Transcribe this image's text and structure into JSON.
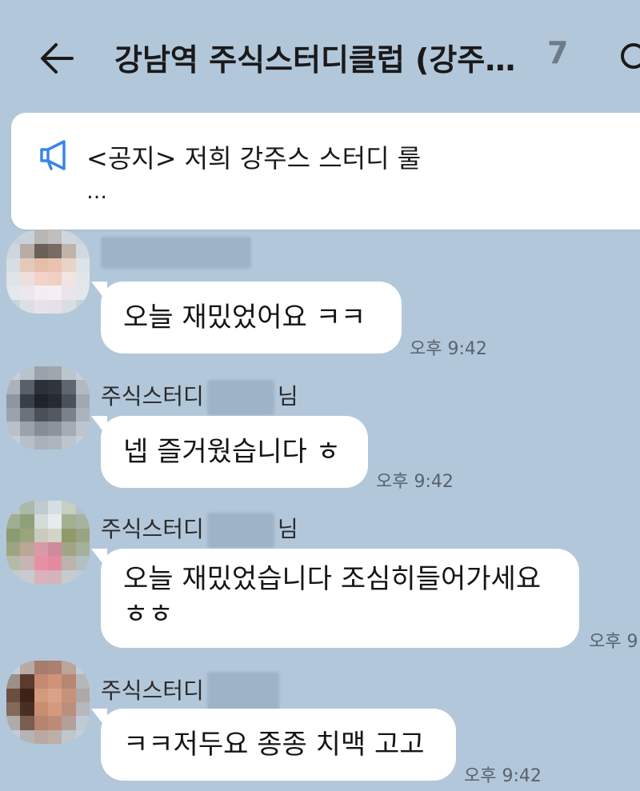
{
  "header": {
    "title": "강남역 주식스터디클럽 (강주…",
    "member_count": "7"
  },
  "notice": {
    "text": "<공지> 저희 강주스 스터디 룰",
    "more": "…"
  },
  "messages": [
    {
      "sender": "",
      "text": "오늘 재밌었어요 ㅋㅋ",
      "time": "오후 9:42"
    },
    {
      "sender": "주식스터디",
      "sender_suffix": "님",
      "text": "넵 즐거웠습니다 ㅎ",
      "time": "오후 9:42"
    },
    {
      "sender": "주식스터디",
      "sender_suffix": "님",
      "text": "오늘 재밌었습니다 조심히들어가세요\nㅎㅎ",
      "time": "오후 9"
    },
    {
      "sender": "주식스터디",
      "sender_suffix": "",
      "text": "ㅋㅋ저두요 종종 치맥 고고",
      "time": "오후 9:42"
    }
  ],
  "colors": {
    "background": "#b2c7da",
    "bubble": "#ffffff",
    "notice_icon": "#3a86e8"
  },
  "icons": {
    "back": "arrow-left-icon",
    "search": "search-icon",
    "notice": "megaphone-icon"
  }
}
